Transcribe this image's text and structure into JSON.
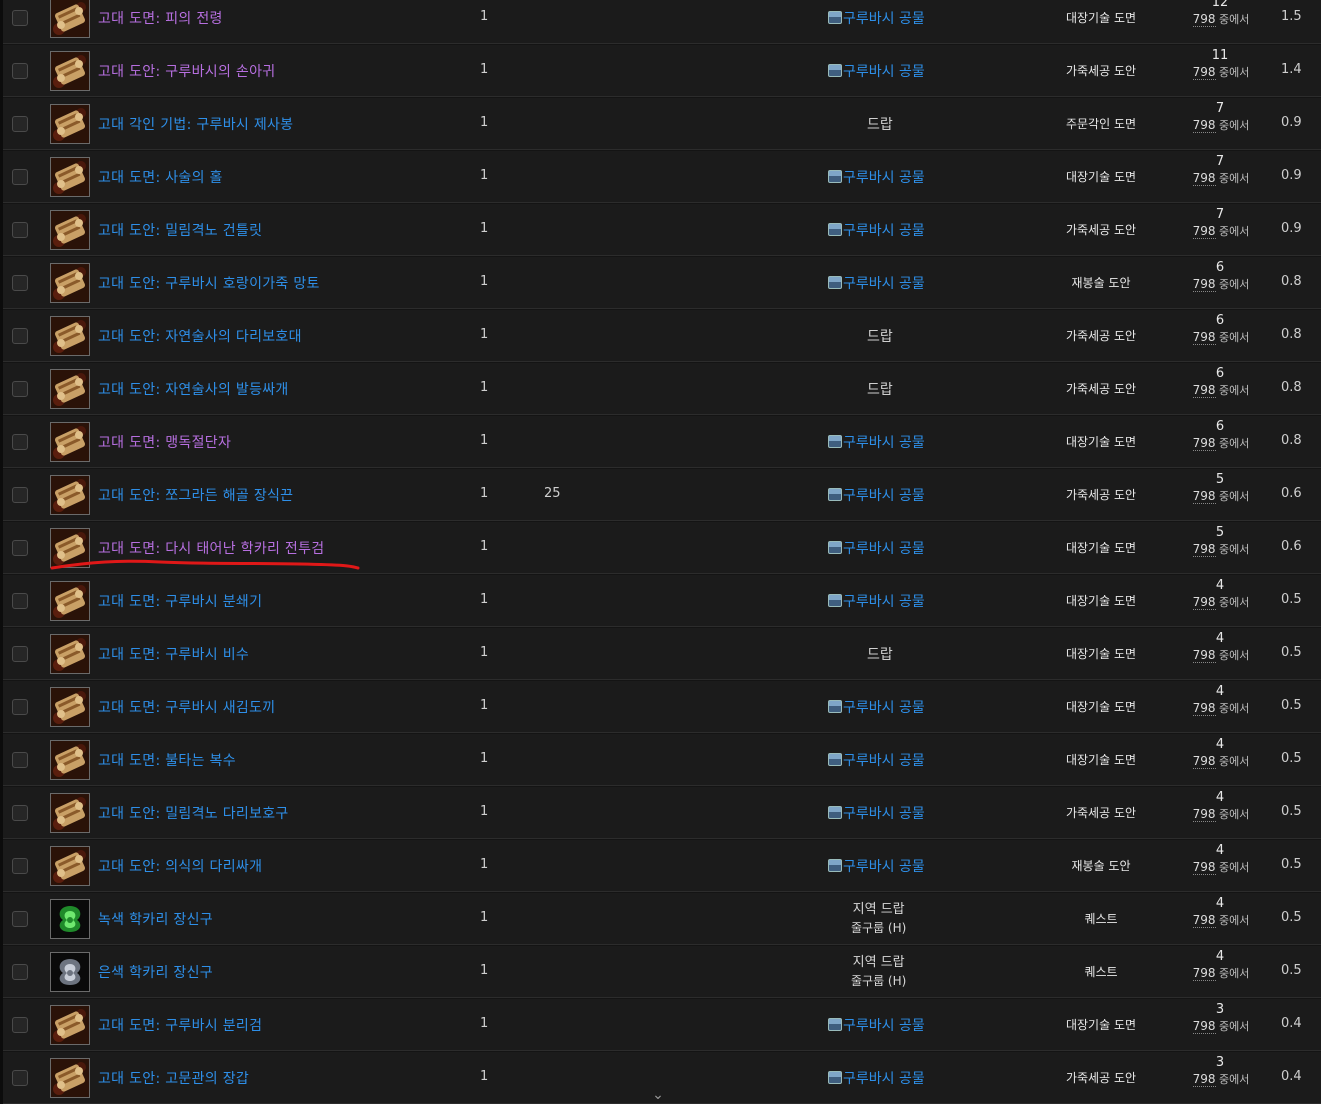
{
  "rows": [
    {
      "name": "고대 도면: 피의 전령",
      "quality": "epic",
      "icon": "scroll-icon",
      "level": "1",
      "req": "",
      "source": "구루바시 공물",
      "source_icon": "chest-icon",
      "type": "대장기술 도면",
      "count": "12",
      "total": "798",
      "total_suffix": "중에서",
      "pct": "1.5"
    },
    {
      "name": "고대 도안: 구루바시의 손아귀",
      "quality": "epic",
      "icon": "scroll-icon",
      "level": "1",
      "req": "",
      "source": "구루바시 공물",
      "source_icon": "chest-icon",
      "type": "가죽세공 도안",
      "count": "11",
      "total": "798",
      "total_suffix": "중에서",
      "pct": "1.4"
    },
    {
      "name": "고대 각인 기법: 구루바시 제사봉",
      "quality": "rare",
      "icon": "scroll-icon",
      "level": "1",
      "req": "",
      "source": "드랍",
      "source_icon": "",
      "type": "주문각인 도면",
      "count": "7",
      "total": "798",
      "total_suffix": "중에서",
      "pct": "0.9"
    },
    {
      "name": "고대 도면: 사술의 홀",
      "quality": "rare",
      "icon": "scroll-icon",
      "level": "1",
      "req": "",
      "source": "구루바시 공물",
      "source_icon": "chest-icon",
      "type": "대장기술 도면",
      "count": "7",
      "total": "798",
      "total_suffix": "중에서",
      "pct": "0.9"
    },
    {
      "name": "고대 도안: 밀림격노 건틀릿",
      "quality": "rare",
      "icon": "scroll-icon",
      "level": "1",
      "req": "",
      "source": "구루바시 공물",
      "source_icon": "chest-icon",
      "type": "가죽세공 도안",
      "count": "7",
      "total": "798",
      "total_suffix": "중에서",
      "pct": "0.9"
    },
    {
      "name": "고대 도안: 구루바시 호랑이가죽 망토",
      "quality": "rare",
      "icon": "scroll-icon",
      "level": "1",
      "req": "",
      "source": "구루바시 공물",
      "source_icon": "chest-icon",
      "type": "재봉술 도안",
      "count": "6",
      "total": "798",
      "total_suffix": "중에서",
      "pct": "0.8"
    },
    {
      "name": "고대 도안: 자연술사의 다리보호대",
      "quality": "rare",
      "icon": "scroll-icon",
      "level": "1",
      "req": "",
      "source": "드랍",
      "source_icon": "",
      "type": "가죽세공 도안",
      "count": "6",
      "total": "798",
      "total_suffix": "중에서",
      "pct": "0.8"
    },
    {
      "name": "고대 도안: 자연술사의 발등싸개",
      "quality": "rare",
      "icon": "scroll-icon",
      "level": "1",
      "req": "",
      "source": "드랍",
      "source_icon": "",
      "type": "가죽세공 도안",
      "count": "6",
      "total": "798",
      "total_suffix": "중에서",
      "pct": "0.8"
    },
    {
      "name": "고대 도면: 맹독절단자",
      "quality": "epic",
      "icon": "scroll-icon",
      "level": "1",
      "req": "",
      "source": "구루바시 공물",
      "source_icon": "chest-icon",
      "type": "대장기술 도면",
      "count": "6",
      "total": "798",
      "total_suffix": "중에서",
      "pct": "0.8"
    },
    {
      "name": "고대 도안: 쪼그라든 해골 장식끈",
      "quality": "rare",
      "icon": "scroll-icon",
      "level": "1",
      "req": "25",
      "source": "구루바시 공물",
      "source_icon": "chest-icon",
      "type": "가죽세공 도안",
      "count": "5",
      "total": "798",
      "total_suffix": "중에서",
      "pct": "0.6"
    },
    {
      "name": "고대 도면: 다시 태어난 학카리 전투검",
      "quality": "epic",
      "icon": "scroll-icon",
      "level": "1",
      "req": "",
      "source": "구루바시 공물",
      "source_icon": "chest-icon",
      "type": "대장기술 도면",
      "count": "5",
      "total": "798",
      "total_suffix": "중에서",
      "pct": "0.6",
      "highlighted": true
    },
    {
      "name": "고대 도면: 구루바시 분쇄기",
      "quality": "rare",
      "icon": "scroll-icon",
      "level": "1",
      "req": "",
      "source": "구루바시 공물",
      "source_icon": "chest-icon",
      "type": "대장기술 도면",
      "count": "4",
      "total": "798",
      "total_suffix": "중에서",
      "pct": "0.5"
    },
    {
      "name": "고대 도면: 구루바시 비수",
      "quality": "rare",
      "icon": "scroll-icon",
      "level": "1",
      "req": "",
      "source": "드랍",
      "source_icon": "",
      "type": "대장기술 도면",
      "count": "4",
      "total": "798",
      "total_suffix": "중에서",
      "pct": "0.5"
    },
    {
      "name": "고대 도면: 구루바시 새김도끼",
      "quality": "rare",
      "icon": "scroll-icon",
      "level": "1",
      "req": "",
      "source": "구루바시 공물",
      "source_icon": "chest-icon",
      "type": "대장기술 도면",
      "count": "4",
      "total": "798",
      "total_suffix": "중에서",
      "pct": "0.5"
    },
    {
      "name": "고대 도면: 불타는 복수",
      "quality": "rare",
      "icon": "scroll-icon",
      "level": "1",
      "req": "",
      "source": "구루바시 공물",
      "source_icon": "chest-icon",
      "type": "대장기술 도면",
      "count": "4",
      "total": "798",
      "total_suffix": "중에서",
      "pct": "0.5"
    },
    {
      "name": "고대 도안: 밀림격노 다리보호구",
      "quality": "rare",
      "icon": "scroll-icon",
      "level": "1",
      "req": "",
      "source": "구루바시 공물",
      "source_icon": "chest-icon",
      "type": "가죽세공 도안",
      "count": "4",
      "total": "798",
      "total_suffix": "중에서",
      "pct": "0.5"
    },
    {
      "name": "고대 도안: 의식의 다리싸개",
      "quality": "rare",
      "icon": "scroll-icon",
      "level": "1",
      "req": "",
      "source": "구루바시 공물",
      "source_icon": "chest-icon",
      "type": "재봉술 도안",
      "count": "4",
      "total": "798",
      "total_suffix": "중에서",
      "pct": "0.5"
    },
    {
      "name": "녹색 학카리 장신구",
      "quality": "rare",
      "icon": "green-trinket-icon",
      "level": "1",
      "req": "",
      "source": "지역 드랍",
      "source_zone": "줄구룹 (H)",
      "source_icon": "",
      "type": "퀘스트",
      "count": "4",
      "total": "798",
      "total_suffix": "중에서",
      "pct": "0.5"
    },
    {
      "name": "은색 학카리 장신구",
      "quality": "rare",
      "icon": "silver-trinket-icon",
      "level": "1",
      "req": "",
      "source": "지역 드랍",
      "source_zone": "줄구룹 (H)",
      "source_icon": "",
      "type": "퀘스트",
      "count": "4",
      "total": "798",
      "total_suffix": "중에서",
      "pct": "0.5"
    },
    {
      "name": "고대 도면: 구루바시 분리검",
      "quality": "rare",
      "icon": "scroll-icon",
      "level": "1",
      "req": "",
      "source": "구루바시 공물",
      "source_icon": "chest-icon",
      "type": "대장기술 도면",
      "count": "3",
      "total": "798",
      "total_suffix": "중에서",
      "pct": "0.4"
    },
    {
      "name": "고대 도안: 고문관의 장갑",
      "quality": "rare",
      "icon": "scroll-icon",
      "level": "1",
      "req": "",
      "source": "구루바시 공물",
      "source_icon": "chest-icon",
      "type": "가죽세공 도안",
      "count": "3",
      "total": "798",
      "total_suffix": "중에서",
      "pct": "0.4"
    }
  ],
  "colors": {
    "epic": "#b76fe0",
    "rare": "#2e8fe8",
    "highlight_underline": "#e01818"
  },
  "scroll_indicator_icon": "chevron-down-icon"
}
